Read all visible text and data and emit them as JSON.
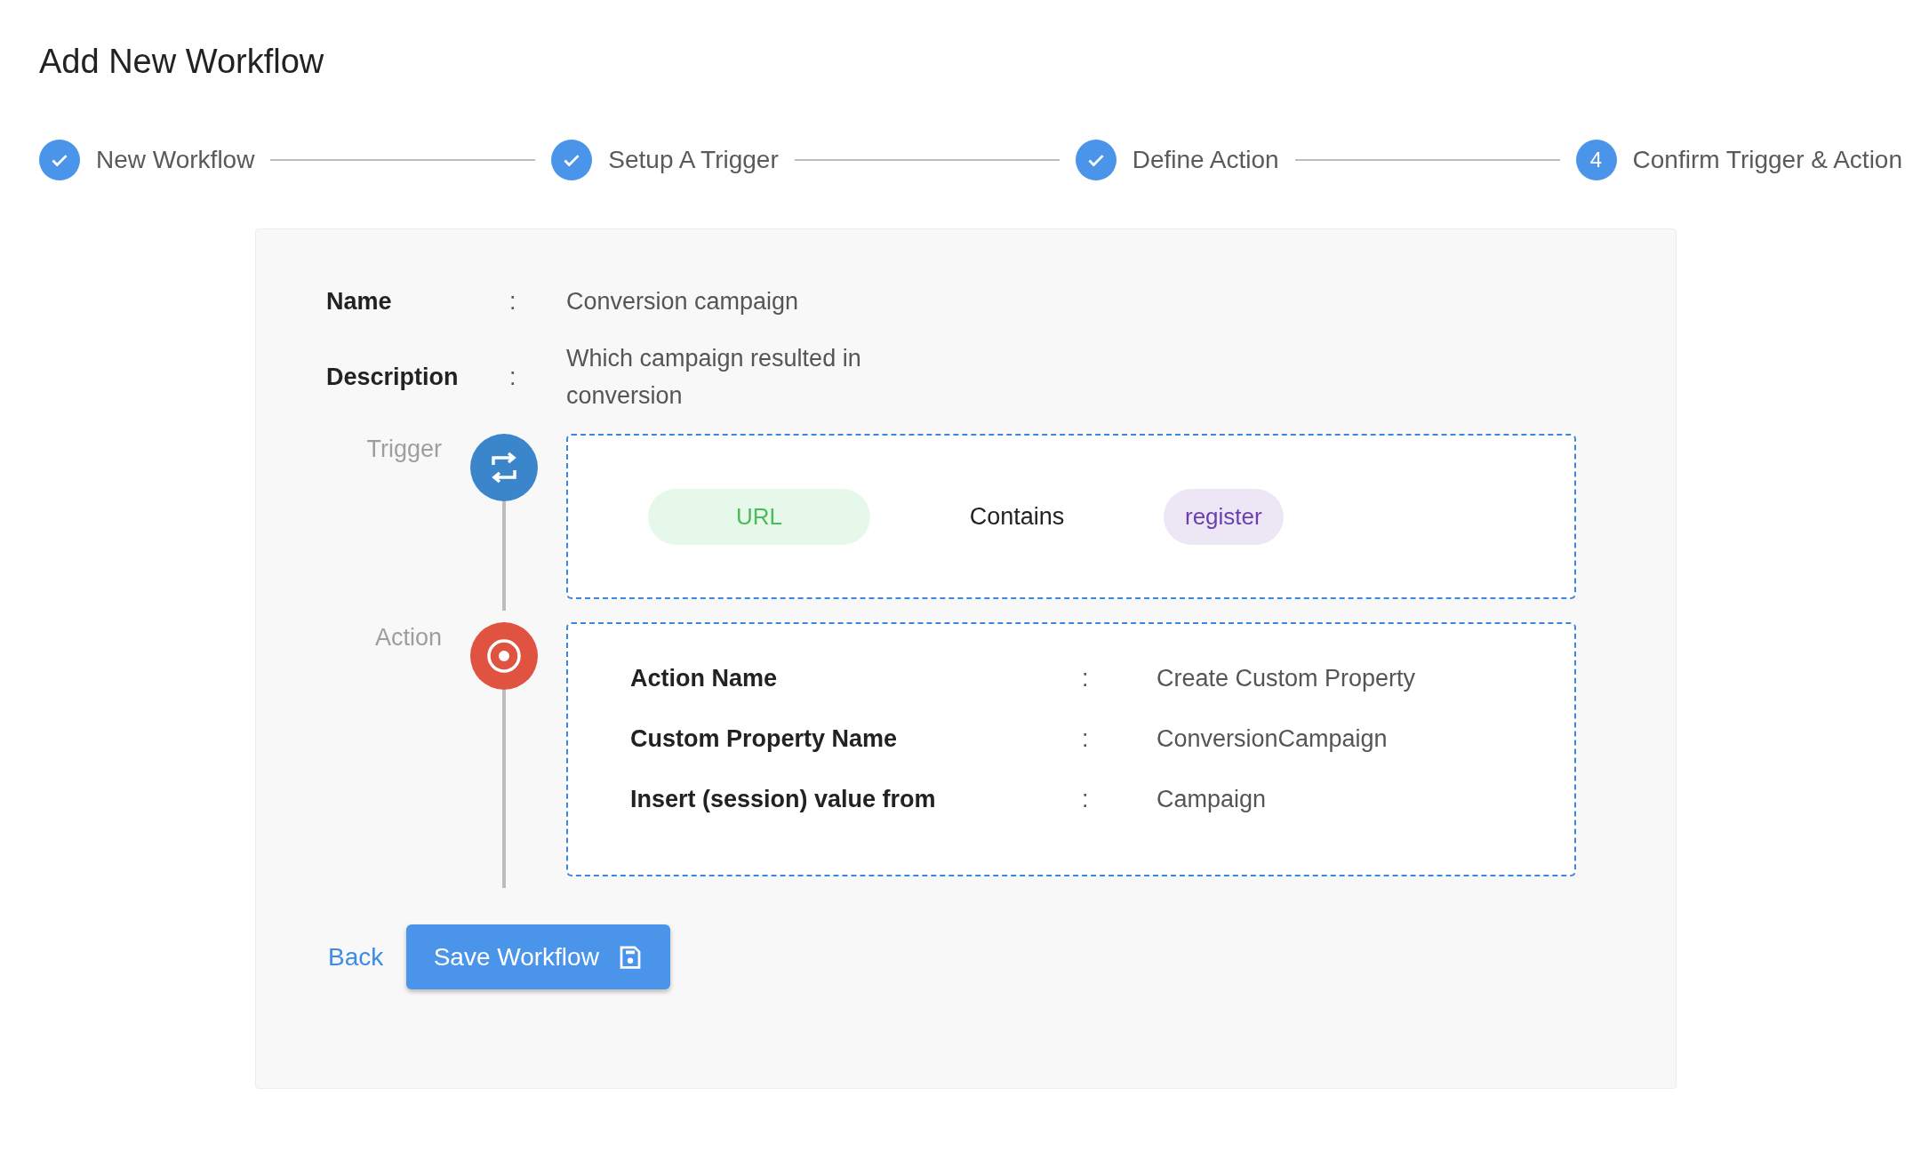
{
  "page": {
    "title": "Add New Workflow"
  },
  "steps": [
    {
      "label": "New Workflow",
      "completed": true
    },
    {
      "label": "Setup A Trigger",
      "completed": true
    },
    {
      "label": "Define Action",
      "completed": true
    },
    {
      "label": "Confirm Trigger & Action",
      "completed": false,
      "number": "4"
    }
  ],
  "summary": {
    "fields": [
      {
        "label": "Name",
        "separator": ":",
        "value": "Conversion campaign"
      },
      {
        "label": "Description",
        "separator": ":",
        "value": "Which campaign resulted in conversion"
      }
    ],
    "trigger": {
      "label": "Trigger",
      "field": "URL",
      "operator": "Contains",
      "value": "register"
    },
    "action": {
      "label": "Action",
      "rows": [
        {
          "label": "Action Name",
          "separator": ":",
          "value": "Create Custom Property"
        },
        {
          "label": "Custom Property Name",
          "separator": ":",
          "value": "ConversionCampaign"
        },
        {
          "label": "Insert (session) value from",
          "separator": ":",
          "value": "Campaign"
        }
      ]
    },
    "buttons": {
      "back": "Back",
      "save": "Save Workflow"
    }
  }
}
